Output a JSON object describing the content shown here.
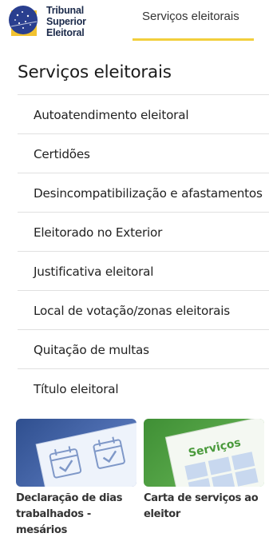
{
  "header": {
    "logo": {
      "line1": "Tribunal",
      "line2": "Superior",
      "line3": "Eleitoral"
    },
    "active_tab": "Serviços eleitorais",
    "tab_underline_color": "#f2cf3c"
  },
  "main": {
    "title": "Serviços eleitorais",
    "menu": [
      {
        "label": "Autoatendimento eleitoral"
      },
      {
        "label": "Certidões"
      },
      {
        "label": "Desincompatibilização e afastamentos"
      },
      {
        "label": "Eleitorado no Exterior"
      },
      {
        "label": "Justificativa eleitoral"
      },
      {
        "label": "Local de votação/zonas eleitorais"
      },
      {
        "label": "Quitação de multas"
      },
      {
        "label": "Título eleitoral"
      }
    ]
  },
  "cards": [
    {
      "caption_l1": "Declaração de dias",
      "caption_l2": "trabalhados -",
      "caption_l3": "mesários",
      "image_icon": "calendar-icon"
    },
    {
      "caption_l1": "Carta de serviços ao",
      "caption_l2": "eleitor",
      "image_text": "Serviços",
      "image_icon": "document-icon"
    }
  ]
}
